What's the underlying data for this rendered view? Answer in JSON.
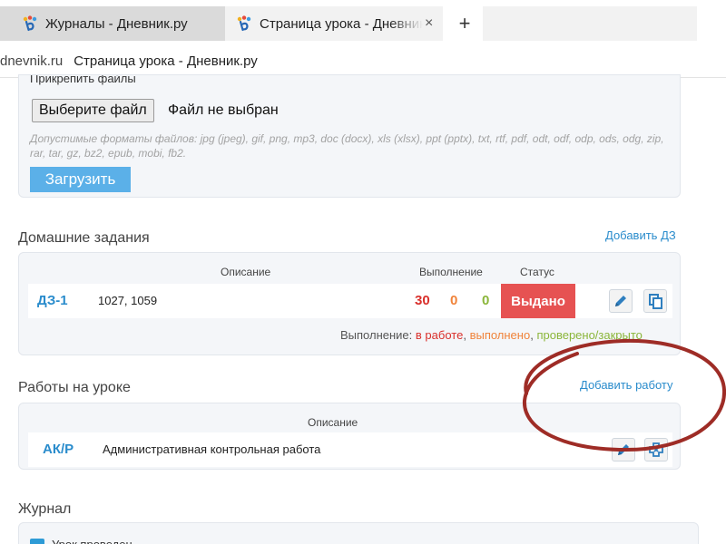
{
  "browser": {
    "tabs": [
      {
        "title": "Журналы - Дневник.ру",
        "icon": "dnevnik-logo"
      },
      {
        "title": "Страница урока - Дневник.ру",
        "icon": "dnevnik-logo",
        "close": "×"
      }
    ],
    "new_tab": "+",
    "address": {
      "domain": "dnevnik.ru",
      "page_title": "Страница урока - Дневник.ру"
    }
  },
  "upload": {
    "attach_label": "Прикрепить файлы",
    "choose_button": "Выберите файл",
    "file_status": "Файл не выбран",
    "formats_hint": "Допустимые форматы файлов: jpg (jpeg), gif, png, mp3, doc (docx), xls (xlsx), ppt (pptx), txt, rtf, pdf, odt, odf, odp, ods, odg, zip, rar, tar, gz, bz2, epub, mobi, fb2.",
    "upload_button": "Загрузить"
  },
  "homework": {
    "title": "Домашние задания",
    "add_link": "Добавить ДЗ",
    "columns": {
      "description": "Описание",
      "completion": "Выполнение",
      "status": "Статус"
    },
    "rows": [
      {
        "code": "ДЗ-1",
        "description": "1027, 1059",
        "in_progress": "30",
        "done": "0",
        "checked": "0",
        "status": "Выдано"
      }
    ],
    "legend": {
      "prefix": "Выполнение:",
      "in_progress": "в работе",
      "done": "выполнено",
      "checked": "проверено/закрыто",
      "sep": ","
    },
    "colors": {
      "in_progress": "#d9302c",
      "done": "#f0833a",
      "checked": "#8bb63a",
      "status_bg": "#e65252"
    }
  },
  "lesson_works": {
    "title": "Работы на уроке",
    "add_link": "Добавить работу",
    "columns": {
      "description": "Описание"
    },
    "rows": [
      {
        "code": "АК/Р",
        "description": "Административная контрольная работа"
      }
    ]
  },
  "journal": {
    "title": "Журнал",
    "checkbox_label": "Урок проведен"
  },
  "annotation": {
    "shape": "hand-drawn ellipse",
    "color": "#9e2c26"
  }
}
